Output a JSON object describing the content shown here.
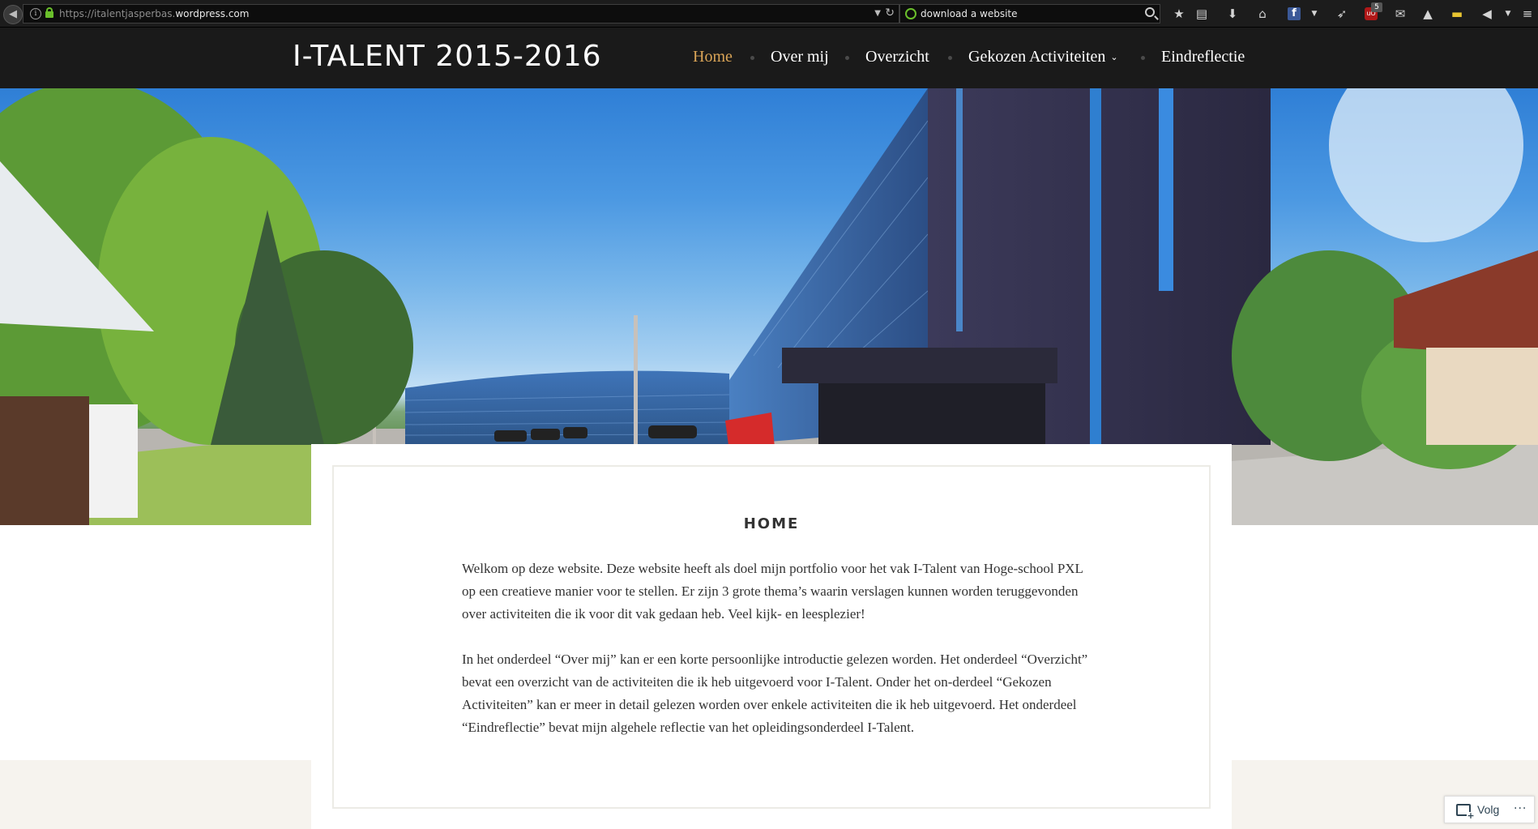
{
  "browser": {
    "url_prefix": "https://italentjasperbas.",
    "url_host": "wordpress.com",
    "search_value": "download a website",
    "ublock_badge": "5"
  },
  "site": {
    "title": "I-TALENT 2015-2016",
    "menu": [
      {
        "label": "Home"
      },
      {
        "label": "Over mij"
      },
      {
        "label": "Overzicht"
      },
      {
        "label": "Gekozen Activiteiten"
      },
      {
        "label": "Eindreflectie"
      }
    ],
    "accent_color": "#d9a457"
  },
  "entry": {
    "title": "HOME",
    "paragraphs": [
      "Welkom op deze website. Deze website heeft als doel mijn portfolio voor het vak I-Talent van Hoge-school PXL op een creatieve manier voor te stellen. Er zijn 3 grote thema’s waarin verslagen kunnen worden teruggevonden over activiteiten die ik voor dit vak gedaan heb. Veel kijk- en leesplezier!",
      "In het onderdeel “Over mij” kan er een korte persoonlijke introductie gelezen worden. Het onderdeel “Overzicht” bevat een overzicht van de activiteiten die ik heb uitgevoerd voor I-Talent. Onder het on-derdeel “Gekozen Activiteiten” kan er meer in detail gelezen worden over enkele activiteiten die ik heb uitgevoerd. Het onderdeel “Eindreflectie” bevat mijn algehele reflectie van het opleidingsonderdeel I-Talent."
    ]
  },
  "follow": {
    "label": "Volg",
    "more": "···"
  }
}
